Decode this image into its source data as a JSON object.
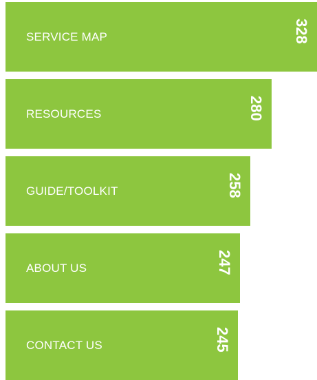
{
  "chart_data": {
    "type": "bar",
    "orientation": "horizontal",
    "categories": [
      "SERVICE MAP",
      "RESOURCES",
      "GUIDE/TOOLKIT",
      "ABOUT US",
      "CONTACT US"
    ],
    "values": [
      328,
      280,
      258,
      247,
      245
    ],
    "value_labels": [
      "328",
      "280",
      "258",
      "247",
      "245"
    ],
    "title": "",
    "xlabel": "",
    "ylabel": "",
    "grid": false,
    "legend": "none",
    "bar_color": "#8dc63f",
    "text_color": "#ffffff"
  }
}
